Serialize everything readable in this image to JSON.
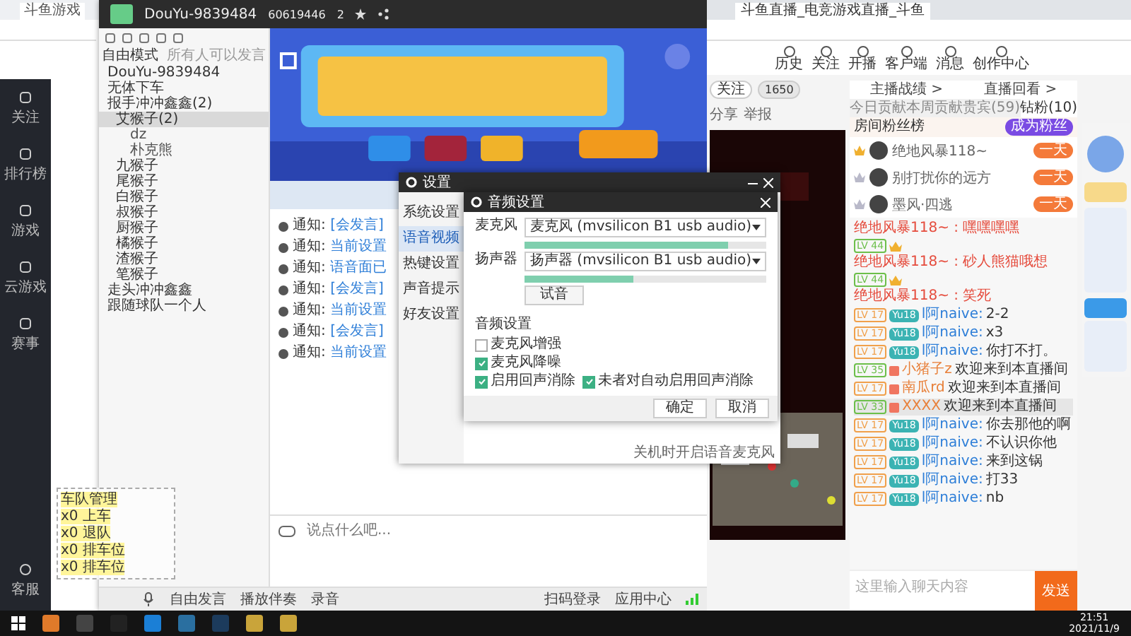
{
  "left_browser": {
    "tab_title": "斗鱼游戏",
    "nav": [
      {
        "label": "关注"
      },
      {
        "label": "排行榜"
      },
      {
        "label": "游戏"
      },
      {
        "label": "云游戏"
      },
      {
        "label": "赛事"
      }
    ],
    "support": "客服"
  },
  "yy": {
    "title": "DouYu-9839484",
    "room_id": "60619446",
    "online": "2",
    "mode": "自由模式",
    "mode_note": "所有人可以发言",
    "tree": [
      {
        "label": "DouYu-9839484"
      },
      {
        "label": "无体下车"
      },
      {
        "label": "报手冲冲鑫鑫(2)",
        "children": [
          {
            "label": "艾猴子(2)",
            "selected": true,
            "children": [
              {
                "label": "dz"
              },
              {
                "label": "朴克熊"
              }
            ]
          },
          {
            "label": "九猴子",
            "selected": false
          },
          {
            "label": "尾猴子",
            "selected": false
          },
          {
            "label": "白猴子",
            "selected": false
          },
          {
            "label": "叔猴子",
            "selected": false
          },
          {
            "label": "厨猴子",
            "selected": false
          },
          {
            "label": "橘猴子",
            "selected": false
          },
          {
            "label": "渣猴子",
            "selected": false
          },
          {
            "label": "笔猴子",
            "selected": false
          }
        ]
      },
      {
        "label": "走头冲冲鑫鑫"
      },
      {
        "label": "跟随球队一个人"
      }
    ],
    "chat": [
      {
        "label": "通知:",
        "text": "[会发言]"
      },
      {
        "label": "通知:",
        "text": "当前设置"
      },
      {
        "label": "通知:",
        "text": "语音面已"
      },
      {
        "label": "通知:",
        "text": "[会发言]"
      },
      {
        "label": "通知:",
        "text": "当前设置"
      },
      {
        "label": "通知:",
        "text": "[会发言]"
      },
      {
        "label": "通知:",
        "text": "当前设置"
      }
    ],
    "input_placeholder": "说点什么吧...",
    "toolbar": [
      {
        "label": "自由发言"
      },
      {
        "label": "播放伴奏"
      },
      {
        "label": "录音"
      }
    ],
    "status": [
      {
        "label": "扫码登录"
      },
      {
        "label": "应用中心"
      }
    ]
  },
  "widget": {
    "title": "车队管理",
    "rows": [
      {
        "text": "x0 上车"
      },
      {
        "text": "x0 退队"
      },
      {
        "text": "x0 排车位"
      },
      {
        "text": "x0 排车位"
      }
    ]
  },
  "settings": {
    "title": "设置",
    "menu": [
      {
        "label": "系统设置",
        "selected": false
      },
      {
        "label": "语音视频",
        "selected": true
      },
      {
        "label": "热键设置",
        "selected": false
      },
      {
        "label": "声音提示",
        "selected": false
      },
      {
        "label": "好友设置",
        "selected": false
      }
    ],
    "behind_text": "关机时开启语音麦克风",
    "audio": {
      "title": "音频设置",
      "devices": [
        {
          "label": "麦克风",
          "device": "麦克风 (mvsilicon B1 usb audio)",
          "level": 0.84
        },
        {
          "label": "扬声器",
          "device": "扬声器 (mvsilicon B1 usb audio)",
          "level": 0.45
        }
      ],
      "test_button": "试音",
      "section": "音频设置",
      "options": [
        {
          "label": "麦克风增强",
          "checked": false
        },
        {
          "label": "麦克风降噪",
          "checked": true
        },
        {
          "label": "启用回声消除",
          "checked": true
        },
        {
          "label": "未者对自动启用回声消除",
          "checked": true
        }
      ],
      "buttons": [
        "确定",
        "取消"
      ]
    }
  },
  "right_browser": {
    "tab_title": "斗鱼直播_电竞游戏直播_斗鱼",
    "nav": [
      {
        "label": "历史"
      },
      {
        "label": "关注"
      },
      {
        "label": "开播"
      },
      {
        "label": "客户端"
      },
      {
        "label": "消息"
      },
      {
        "label": "创作中心"
      }
    ],
    "follow": "关注",
    "followers": "1650",
    "share": "分享",
    "report": "举报",
    "links": [
      "主播战绩 >",
      "直播回看 >"
    ],
    "rank_tabs": [
      {
        "label": "今日贡献",
        "selected": false
      },
      {
        "label": "本周贡献",
        "selected": false
      },
      {
        "label": "贵宾(59)",
        "selected": false
      },
      {
        "label": "钻粉(10)",
        "selected": true
      }
    ],
    "rank_title": "房间粉丝榜",
    "rank_button": "成为粉丝",
    "ranks": [
      {
        "name": "绝地风暴118~",
        "badge": "一天"
      },
      {
        "name": "别打扰你的远方",
        "badge": "一天"
      },
      {
        "name": "墨风·四逃",
        "badge": "一天"
      }
    ],
    "messages": [
      {
        "kind": "plain",
        "name": "绝地风暴118~ :",
        "text": "嘿嘿嘿嘿"
      },
      {
        "kind": "badges",
        "level": "LV 44",
        "color": "#6cbf4a"
      },
      {
        "kind": "plain",
        "name": "绝地风暴118~ :",
        "text": "砂人熊猫哦想"
      },
      {
        "kind": "badges",
        "level": "LV 44",
        "color": "#6cbf4a"
      },
      {
        "kind": "plain",
        "name": "绝地风暴118~ :",
        "text": "笑死"
      },
      {
        "kind": "chat",
        "level": "LV 17",
        "color": "#f0a04b",
        "fan": "Yu18",
        "name": "l阿naive:",
        "text": "2-2"
      },
      {
        "kind": "chat",
        "level": "LV 17",
        "color": "#f0a04b",
        "fan": "Yu18",
        "name": "l阿naive:",
        "text": "x3"
      },
      {
        "kind": "chat",
        "level": "LV 17",
        "color": "#f0a04b",
        "fan": "Yu18",
        "name": "l阿naive:",
        "text": "你打不打。"
      },
      {
        "kind": "enter",
        "level": "LV 35",
        "color": "#6cbf4a",
        "name": "小猪子z",
        "text": "欢迎来到本直播间"
      },
      {
        "kind": "enter",
        "level": "LV 17",
        "color": "#f0a04b",
        "name": "南瓜rd",
        "text": "欢迎来到本直播间"
      },
      {
        "kind": "enter",
        "level": "LV 33",
        "color": "#6cbf4a",
        "name": "XXXX",
        "text": "欢迎来到本直播间"
      },
      {
        "kind": "chat",
        "level": "LV 17",
        "color": "#f0a04b",
        "fan": "Yu18",
        "name": "l阿naive:",
        "text": "你去那他的啊"
      },
      {
        "kind": "chat",
        "level": "LV 17",
        "color": "#f0a04b",
        "fan": "Yu18",
        "name": "l阿naive:",
        "text": "不认识你他"
      },
      {
        "kind": "chat",
        "level": "LV 17",
        "color": "#f0a04b",
        "fan": "Yu18",
        "name": "l阿naive:",
        "text": "来到这锅"
      },
      {
        "kind": "chat",
        "level": "LV 17",
        "color": "#f0a04b",
        "fan": "Yu18",
        "name": "l阿naive:",
        "text": "打33"
      },
      {
        "kind": "chat",
        "level": "LV 17",
        "color": "#f0a04b",
        "fan": "Yu18",
        "name": "l阿naive:",
        "text": "nb"
      }
    ],
    "input_placeholder": "这里输入聊天内容",
    "send": "发送"
  },
  "taskbar": {
    "time": "21:51",
    "date": "2021/11/9"
  }
}
